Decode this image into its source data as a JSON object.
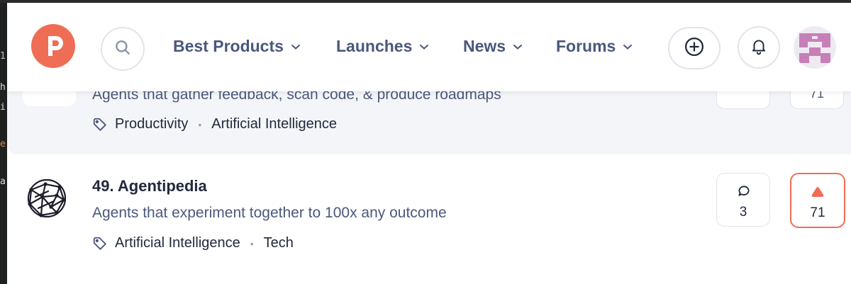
{
  "header": {
    "logo_letter": "P",
    "nav": [
      {
        "label": "Best Products"
      },
      {
        "label": "Launches"
      },
      {
        "label": "News"
      },
      {
        "label": "Forums"
      }
    ],
    "icons": {
      "search": "search-icon",
      "add": "plus-circle-icon",
      "notifications": "bell-icon",
      "avatar": "user-avatar"
    }
  },
  "previous_product": {
    "tagline": "Agents that gather feedback, scan code, & produce roadmaps",
    "topics": [
      "Productivity",
      "Artificial Intelligence"
    ],
    "upvotes_partial": "71"
  },
  "product": {
    "title": "49. Agentipedia",
    "tagline": "Agents that experiment together to 100x any outcome",
    "topics": [
      "Artificial Intelligence",
      "Tech"
    ],
    "comments": "3",
    "upvotes": "71"
  },
  "colors": {
    "accent": "#ef6d55",
    "text": "#21293c",
    "muted": "#4b587c",
    "border": "#e1e4ea",
    "highlight_bg": "#f4f5f8"
  }
}
